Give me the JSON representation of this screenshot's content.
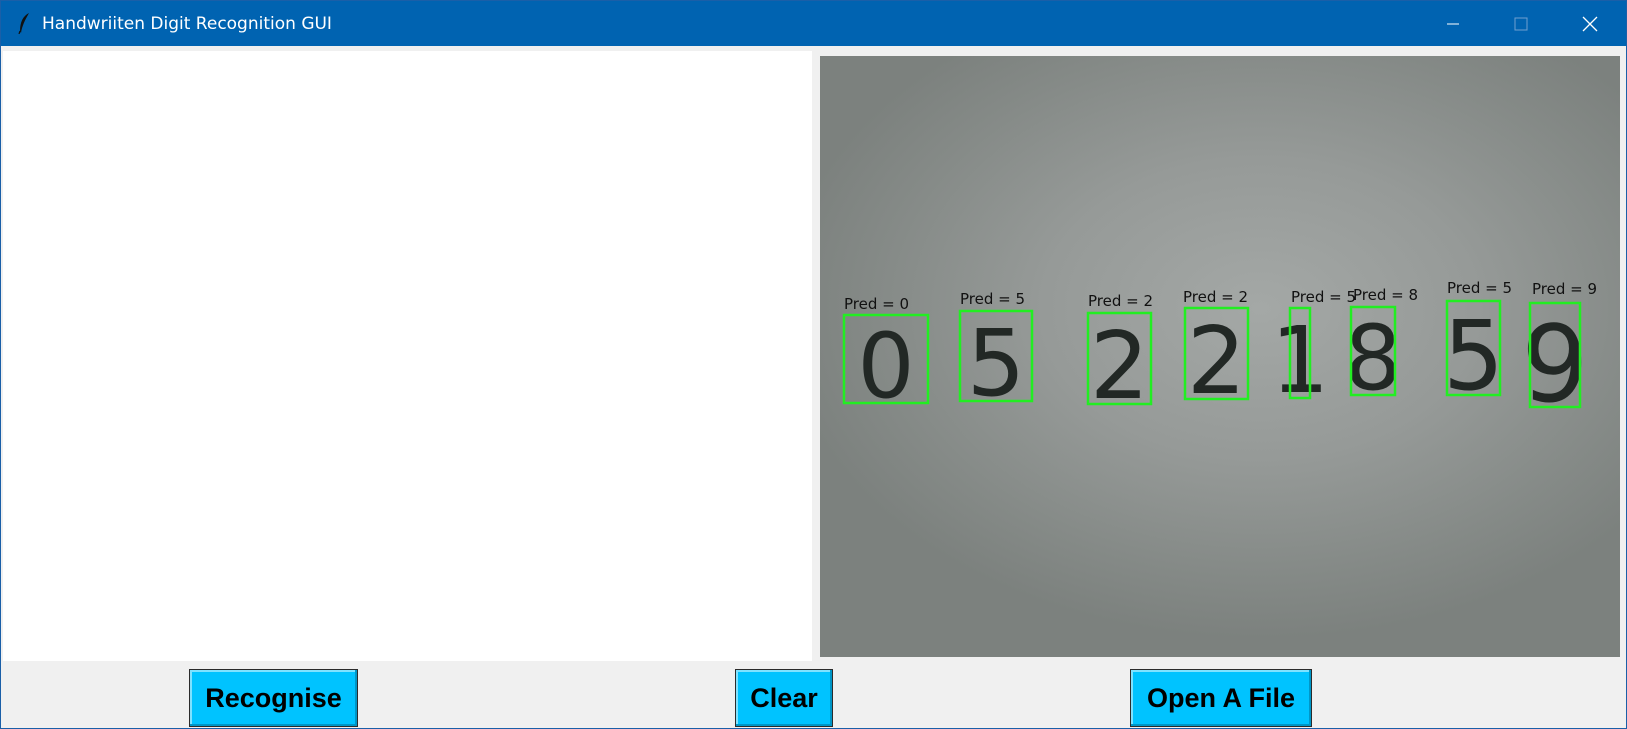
{
  "window": {
    "title": "Handwriiten Digit Recognition GUI",
    "icons": {
      "app": "feather-icon",
      "minimize": "minimize-icon",
      "maximize": "maximize-icon",
      "close": "close-icon"
    }
  },
  "image_panel": {
    "predictions": [
      {
        "label": "Pred = 0",
        "digit": "0"
      },
      {
        "label": "Pred = 5",
        "digit": "5"
      },
      {
        "label": "Pred = 2",
        "digit": "2"
      },
      {
        "label": "Pred = 2",
        "digit": "2"
      },
      {
        "label": "Pred = 5",
        "digit": "1"
      },
      {
        "label": "Pred = 8",
        "digit": "8"
      },
      {
        "label": "Pred = 5",
        "digit": "5"
      },
      {
        "label": "Pred = 9",
        "digit": "9"
      }
    ],
    "box_color": "#22ee22"
  },
  "buttons": {
    "recognise": "Recognise",
    "clear": "Clear",
    "open_file": "Open A File",
    "color": "#00c3ff"
  },
  "colors": {
    "titlebar": "#0063b1",
    "background": "#f0f0f0"
  }
}
